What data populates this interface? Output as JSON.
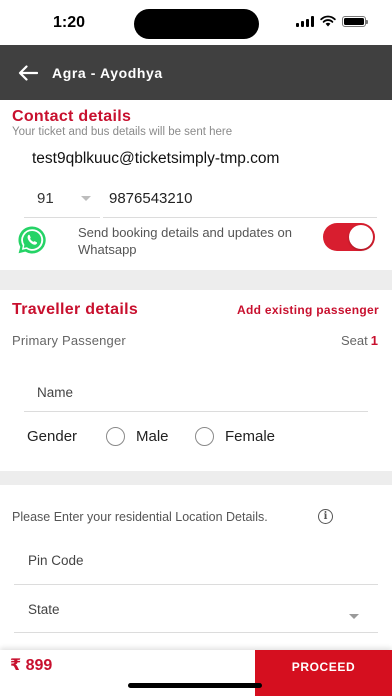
{
  "status_bar": {
    "time": "1:20"
  },
  "header": {
    "back_icon": "arrow-left-icon",
    "title": "Agra - Ayodhya"
  },
  "contact": {
    "title": "Contact details",
    "subtitle": "Your ticket and bus details will be sent here",
    "email": "test9qblkuuc@ticketsimply-tmp.com",
    "country_code": "91",
    "phone": "9876543210",
    "whatsapp_text": "Send booking details and updates on Whatsapp",
    "whatsapp_opt_in": true,
    "whatsapp_icon": "whatsapp-icon"
  },
  "traveller": {
    "title": "Traveller details",
    "add_existing_label": "Add existing passenger",
    "primary_label": "Primary Passenger",
    "seat_label": "Seat",
    "seat_number": "1",
    "name_placeholder": "Name",
    "gender_label": "Gender",
    "gender_options": [
      "Male",
      "Female"
    ]
  },
  "location": {
    "prompt": "Please Enter your residential Location Details.",
    "info_icon": "info-icon",
    "pin_placeholder": "Pin Code",
    "state_placeholder": "State"
  },
  "footer": {
    "fare": "₹ 899",
    "proceed_label": "PROCEED"
  },
  "colors": {
    "accent": "#c8102e",
    "header_bg": "#404040",
    "proceed_bg": "#d50f1f",
    "toggle_on": "#d81e2f",
    "whatsapp": "#25d366"
  }
}
